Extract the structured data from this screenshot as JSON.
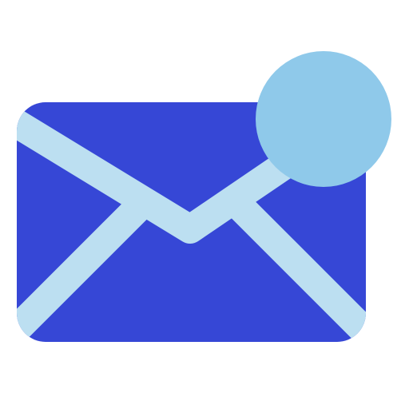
{
  "icon": {
    "name": "mail-notification-icon",
    "colors": {
      "envelope_body": "#3647D6",
      "envelope_lines": "#BCDFF1",
      "notification_dot": "#8FC9EA",
      "background": "#FFFFFF"
    }
  }
}
